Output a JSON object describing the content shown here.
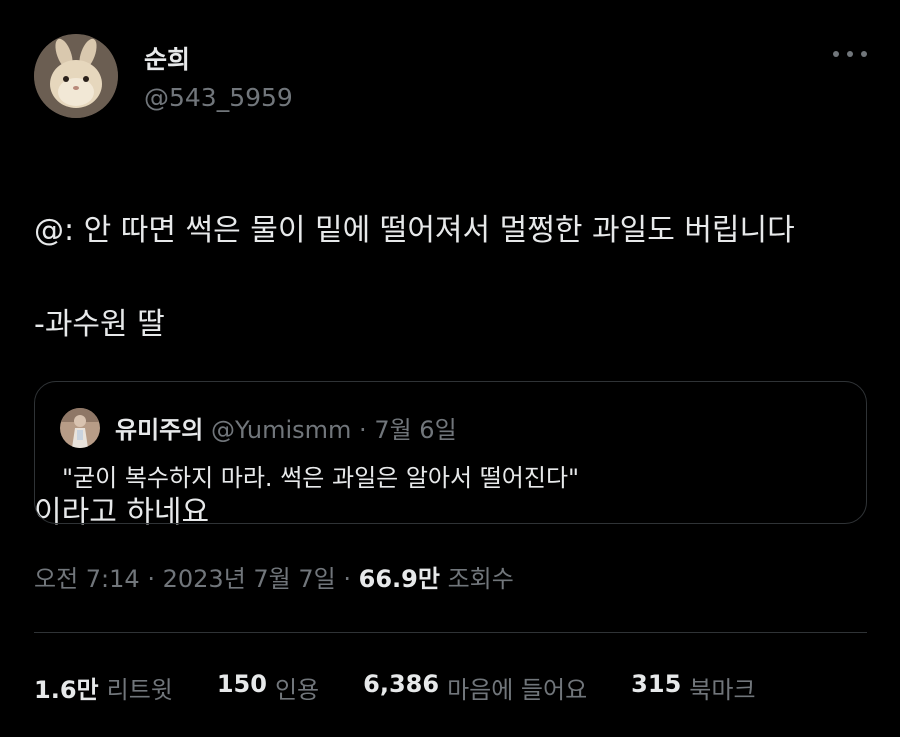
{
  "author": {
    "name": "순희",
    "handle": "@543_5959",
    "avatar": "rabbit-avatar"
  },
  "tweet": {
    "lines": [
      "@: 안 따면 썩은 물이 밑에 떨어져서 멀쩡한 과일도 버립니다",
      "-과수원 딸",
      "이라고 하네요"
    ]
  },
  "quoted": {
    "name": "유미주의",
    "handle": "@Yumismm",
    "dot": "·",
    "date": "7월 6일",
    "text": "\"굳이 복수하지 마라. 썩은 과일은 알아서 떨어진다\""
  },
  "meta": {
    "time": "오전 7:14",
    "sep1": "·",
    "date": "2023년 7월 7일",
    "sep2": "·",
    "views_count": "66.9만",
    "views_label": "조회수"
  },
  "stats": {
    "retweets": {
      "count": "1.6만",
      "label": "리트윗"
    },
    "quotes": {
      "count": "150",
      "label": "인용"
    },
    "likes": {
      "count": "6,386",
      "label": "마음에 들어요"
    },
    "bookmarks": {
      "count": "315",
      "label": "북마크"
    }
  },
  "colors": {
    "background": "#000000",
    "primary_text": "#e7e9ea",
    "secondary_text": "#71767b",
    "border": "#2f3336"
  }
}
